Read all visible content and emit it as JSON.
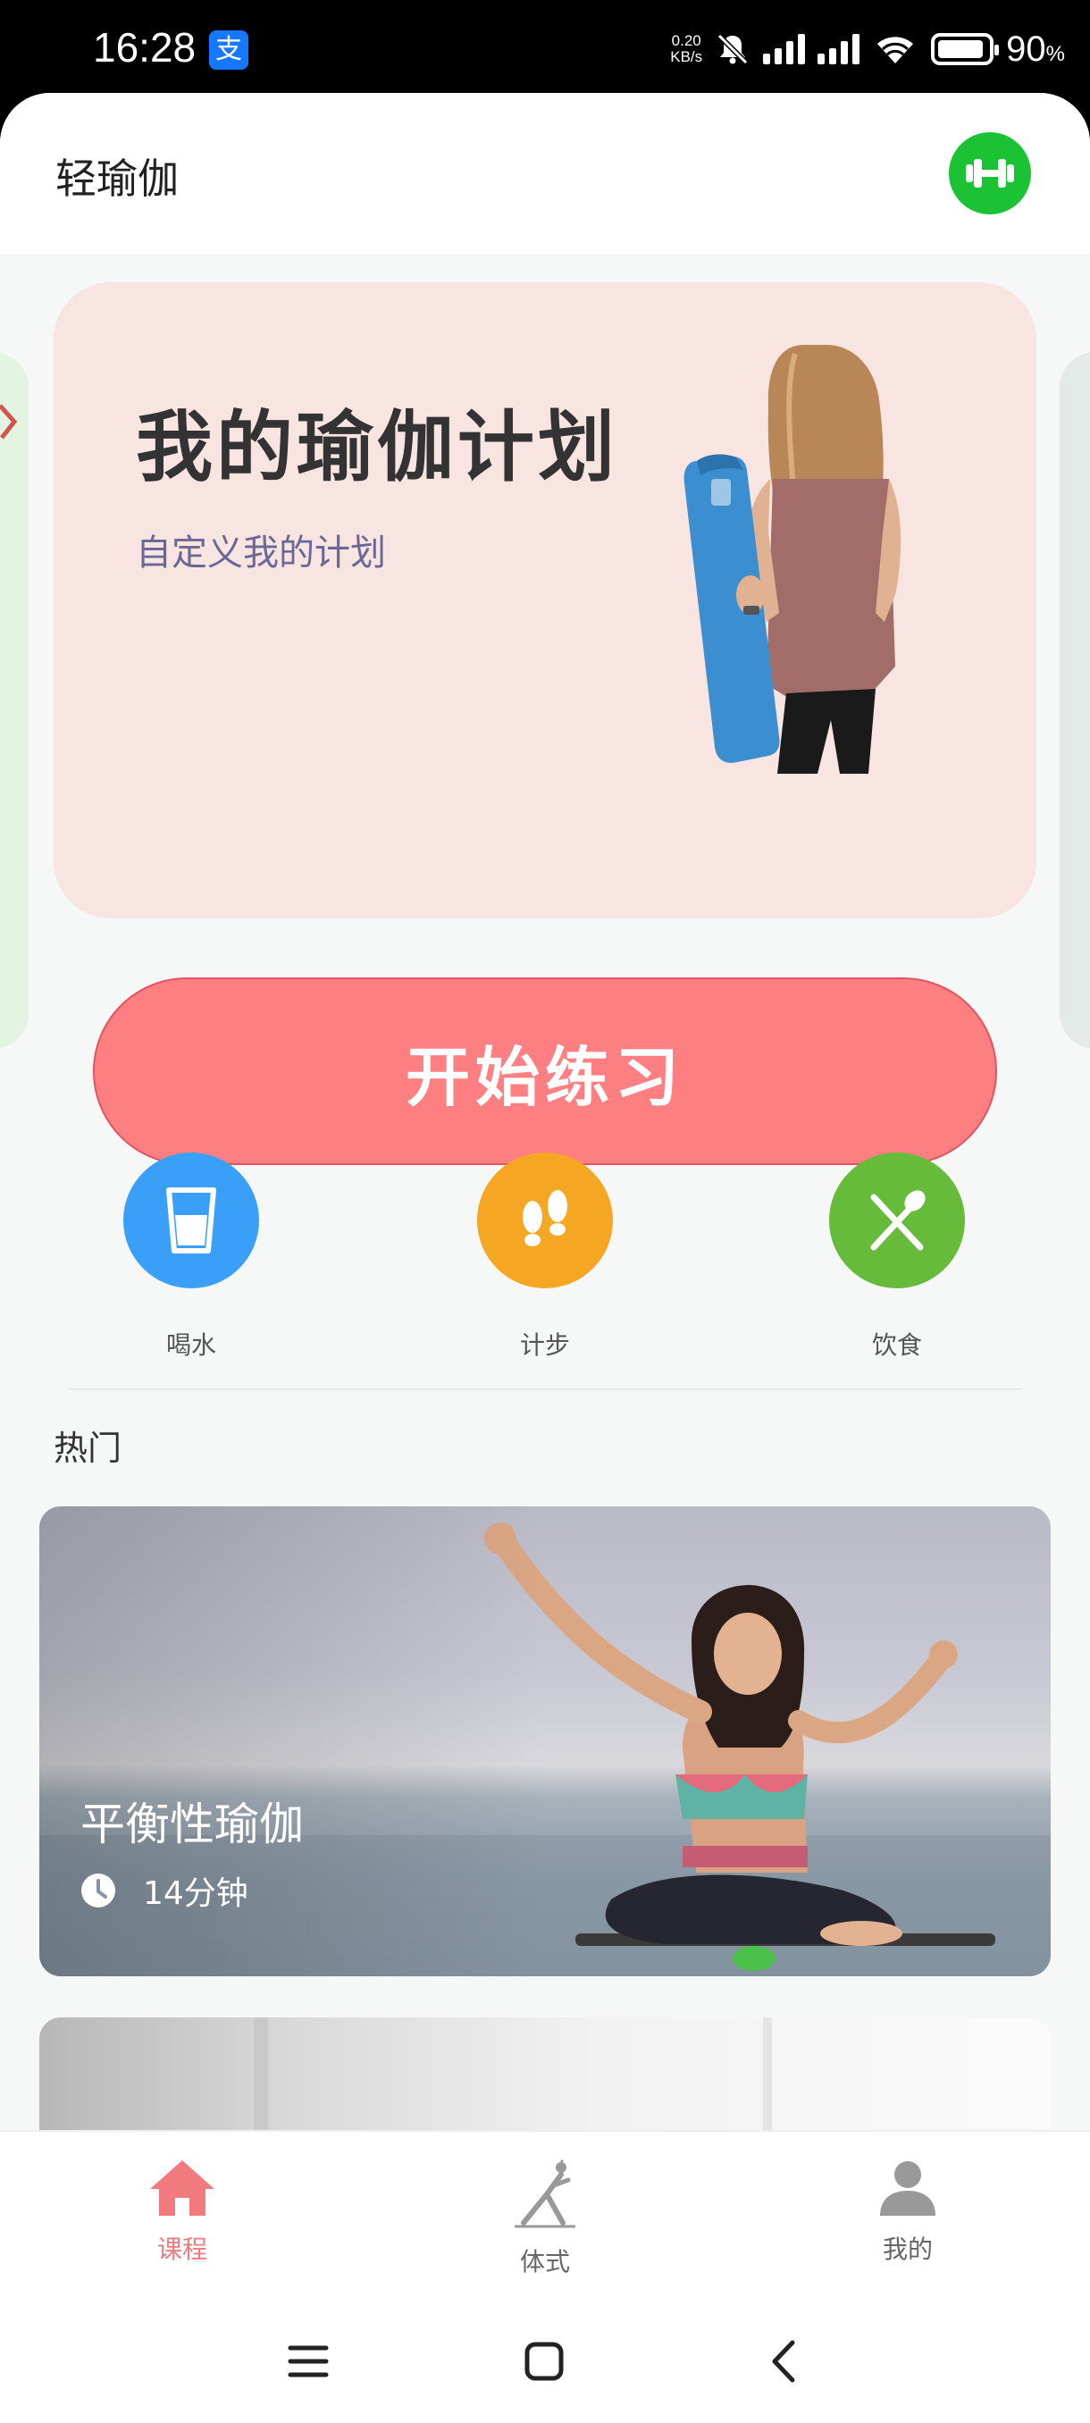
{
  "status_bar": {
    "time": "16:28",
    "app_icon_glyph": "支",
    "net_speed_value": "0.20",
    "net_speed_unit": "KB/s",
    "battery_percent": "90",
    "battery_unit": "%"
  },
  "header": {
    "title": "轻瑜伽",
    "action_icon": "dumbbell-icon",
    "action_color": "#1bc233"
  },
  "plan_card": {
    "title": "我的瑜伽计划",
    "subtitle": "自定义我的计划",
    "button_label": "开始练习",
    "button_color": "#fd7f82"
  },
  "quick_actions": [
    {
      "label": "喝水",
      "icon": "water-glass-icon",
      "color": "#3aa0f7"
    },
    {
      "label": "计步",
      "icon": "footprints-icon",
      "color": "#f5a623"
    },
    {
      "label": "饮食",
      "icon": "utensils-icon",
      "color": "#66bb3a"
    }
  ],
  "hot_section": {
    "title": "热门",
    "courses": [
      {
        "name": "平衡性瑜伽",
        "duration": "14分钟"
      }
    ]
  },
  "tab_bar": {
    "active_color": "#f07a7e",
    "items": [
      {
        "label": "课程",
        "icon": "home-icon",
        "active": true
      },
      {
        "label": "体式",
        "icon": "yoga-pose-icon",
        "active": false
      },
      {
        "label": "我的",
        "icon": "person-icon",
        "active": false
      }
    ]
  },
  "nav_bar": {
    "buttons": [
      "menu-icon",
      "home-square-icon",
      "back-icon"
    ]
  }
}
